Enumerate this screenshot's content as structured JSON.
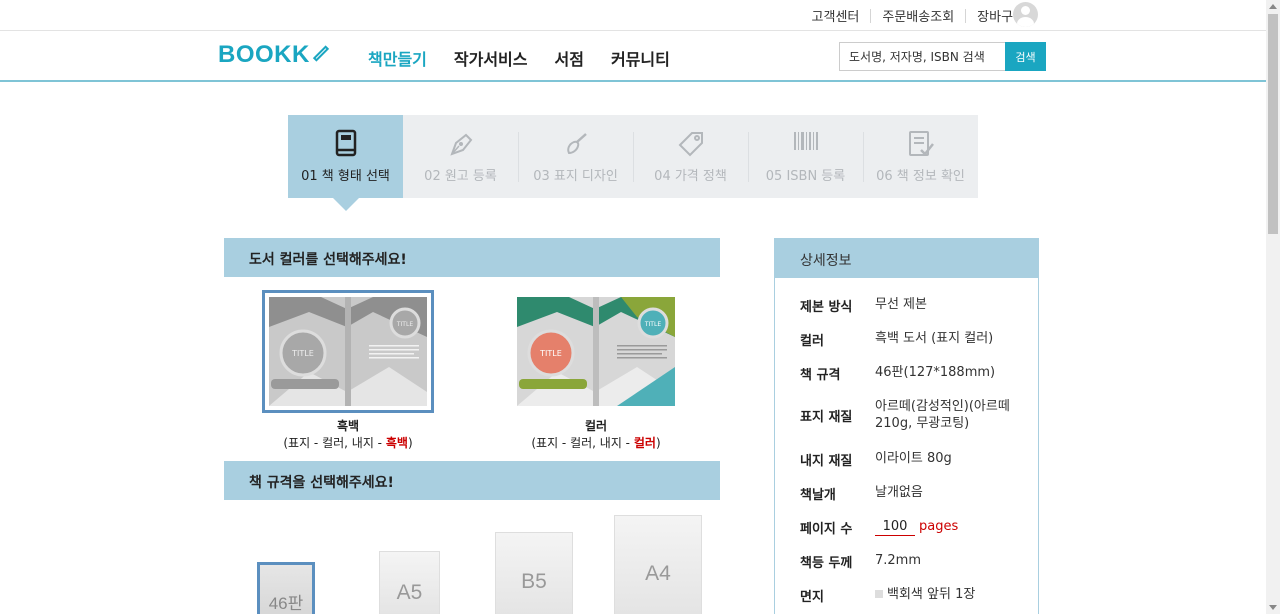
{
  "util": {
    "links": [
      "고객센터",
      "주문배송조회",
      "장바구니"
    ]
  },
  "header": {
    "logo": "BOOKK",
    "menu": [
      "책만들기",
      "작가서비스",
      "서점",
      "커뮤니티"
    ],
    "search_placeholder": "도서명, 저자명, ISBN 검색",
    "search_button": "검색"
  },
  "steps": [
    {
      "label": "01 책 형태 선택",
      "icon": "book-icon",
      "active": true
    },
    {
      "label": "02 원고 등록",
      "icon": "pen-nib-icon",
      "active": false
    },
    {
      "label": "03 표지 디자인",
      "icon": "brush-icon",
      "active": false
    },
    {
      "label": "04 가격 정책",
      "icon": "price-tag-icon",
      "active": false
    },
    {
      "label": "05 ISBN 등록",
      "icon": "barcode-icon",
      "active": false
    },
    {
      "label": "06 책 정보 확인",
      "icon": "checklist-icon",
      "active": false
    }
  ],
  "color_section": {
    "title": "도서 컬러를 선택해주세요!",
    "options": [
      {
        "name": "흑백",
        "desc_prefix": "(표지 - 컬러, 내지 - ",
        "desc_em": "흑백",
        "desc_suffix": ")",
        "thumb_title": "TITLE",
        "selected": true
      },
      {
        "name": "컬러",
        "desc_prefix": "(표지 - 컬러, 내지 - ",
        "desc_em": "컬러",
        "desc_suffix": ")",
        "thumb_title": "TITLE",
        "selected": false
      }
    ]
  },
  "size_section": {
    "title": "책 규격을 선택해주세요!",
    "sizes": [
      {
        "label": "46판",
        "selected": true
      },
      {
        "label": "A5",
        "selected": false
      },
      {
        "label": "B5",
        "selected": false
      },
      {
        "label": "A4",
        "selected": false
      }
    ]
  },
  "details": {
    "title": "상세정보",
    "rows": [
      {
        "key": "제본 방식",
        "value": "무선 제본"
      },
      {
        "key": "컬러",
        "value": "흑백 도서 (표지 컬러)"
      },
      {
        "key": "책 규격",
        "value": "46판(127*188mm)"
      },
      {
        "key": "표지 재질",
        "value": "아르떼(감성적인)(아르떼 210g, 무광코팅)"
      },
      {
        "key": "내지 재질",
        "value": "이라이트 80g"
      },
      {
        "key": "책날개",
        "value": "날개없음"
      },
      {
        "key": "페이지 수",
        "value": "100",
        "unit": "pages"
      },
      {
        "key": "책등 두께",
        "value": "7.2mm"
      },
      {
        "key": "면지",
        "value": "백회색 앞뒤 1장"
      }
    ]
  },
  "colors": {
    "accent": "#1aa6c1",
    "step_active": "#a9cfe0",
    "selected_border": "#5b8fbf",
    "emphasis_red": "#cc0000"
  }
}
